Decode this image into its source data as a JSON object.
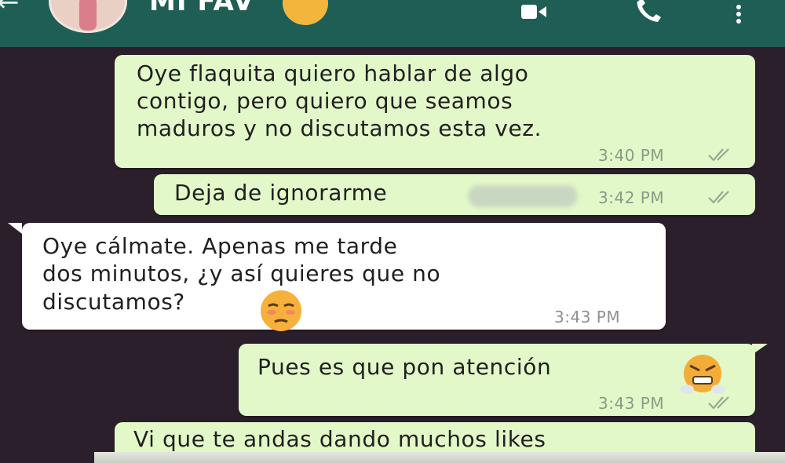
{
  "header": {
    "contact_name": "MI FAV",
    "name_emoji": "smiling-face-with-heart-eyes-emoji",
    "back_icon": "back-arrow-icon",
    "video_icon": "video-call-icon",
    "call_icon": "phone-call-icon",
    "menu_icon": "more-vert-icon",
    "colors": {
      "header_bg": "#1f5e55",
      "chat_bg": "#2b1f2b",
      "outgoing_bubble": "#e3f8c8",
      "incoming_bubble": "#ffffff"
    }
  },
  "messages": [
    {
      "direction": "out",
      "lines": [
        "Oye flaquita quiero hablar de algo",
        "contigo, pero quiero que seamos",
        "maduros y no discutamos esta vez."
      ],
      "time": "3:40 PM",
      "status": "read-double-check"
    },
    {
      "direction": "out",
      "lines": [
        "Deja de ignorarme"
      ],
      "redacted": "blurred-word",
      "time": "3:42 PM",
      "status": "read-double-check"
    },
    {
      "direction": "in",
      "lines": [
        "Oye cálmate. Apenas me tarde",
        "dos minutos, ¿y así quieres que no",
        "discutamos?"
      ],
      "emoji": "pouting-annoyed-face-emoji",
      "time": "3:43 PM"
    },
    {
      "direction": "out",
      "lines": [
        "Pues es que pon atención"
      ],
      "emoji": "face-with-steam-from-nose-emoji",
      "time": "3:43 PM",
      "status": "read-double-check"
    },
    {
      "direction": "out",
      "lines": [
        "Vi que te andas dando muchos likes"
      ]
    }
  ]
}
